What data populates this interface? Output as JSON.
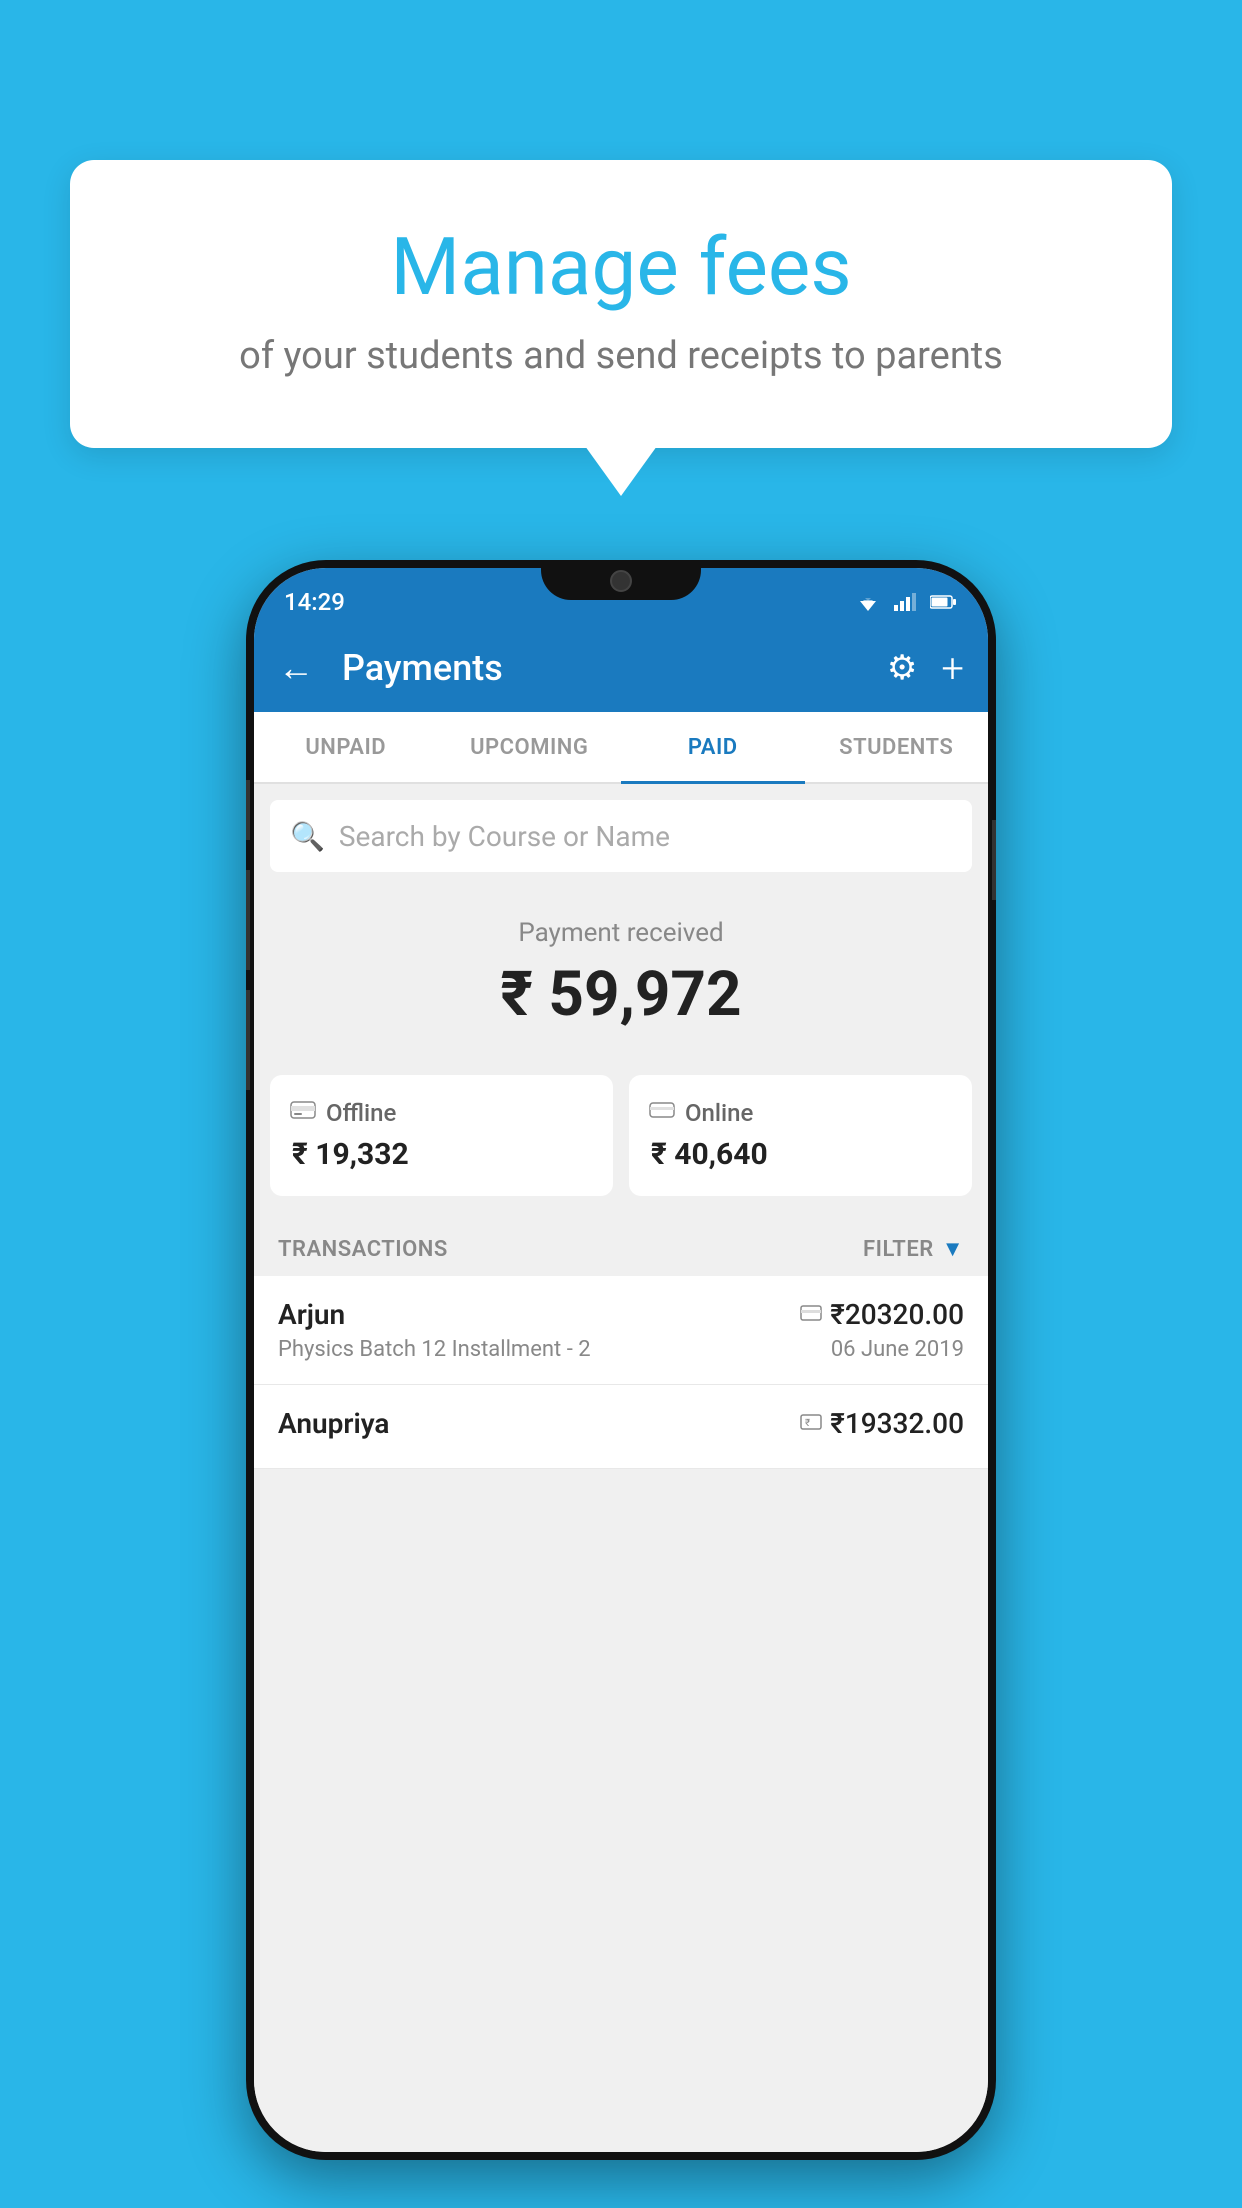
{
  "background": {
    "color": "#29b6e8"
  },
  "speech_bubble": {
    "title": "Manage fees",
    "subtitle": "of your students and send receipts to parents"
  },
  "phone": {
    "status_bar": {
      "time": "14:29"
    },
    "app_bar": {
      "title": "Payments",
      "back_label": "←",
      "gear_label": "⚙",
      "plus_label": "+"
    },
    "tabs": [
      {
        "label": "UNPAID",
        "active": false
      },
      {
        "label": "UPCOMING",
        "active": false
      },
      {
        "label": "PAID",
        "active": true
      },
      {
        "label": "STUDENTS",
        "active": false
      }
    ],
    "search": {
      "placeholder": "Search by Course or Name"
    },
    "payment_received": {
      "label": "Payment received",
      "amount": "₹ 59,972"
    },
    "payment_cards": [
      {
        "type": "Offline",
        "amount": "₹ 19,332",
        "icon": "rupee-card-icon"
      },
      {
        "type": "Online",
        "amount": "₹ 40,640",
        "icon": "credit-card-icon"
      }
    ],
    "transactions": {
      "header_label": "TRANSACTIONS",
      "filter_label": "FILTER",
      "items": [
        {
          "name": "Arjun",
          "course": "Physics Batch 12 Installment - 2",
          "amount": "₹20320.00",
          "date": "06 June 2019",
          "payment_type": "online"
        },
        {
          "name": "Anupriya",
          "course": "",
          "amount": "₹19332.00",
          "date": "",
          "payment_type": "offline"
        }
      ]
    }
  }
}
